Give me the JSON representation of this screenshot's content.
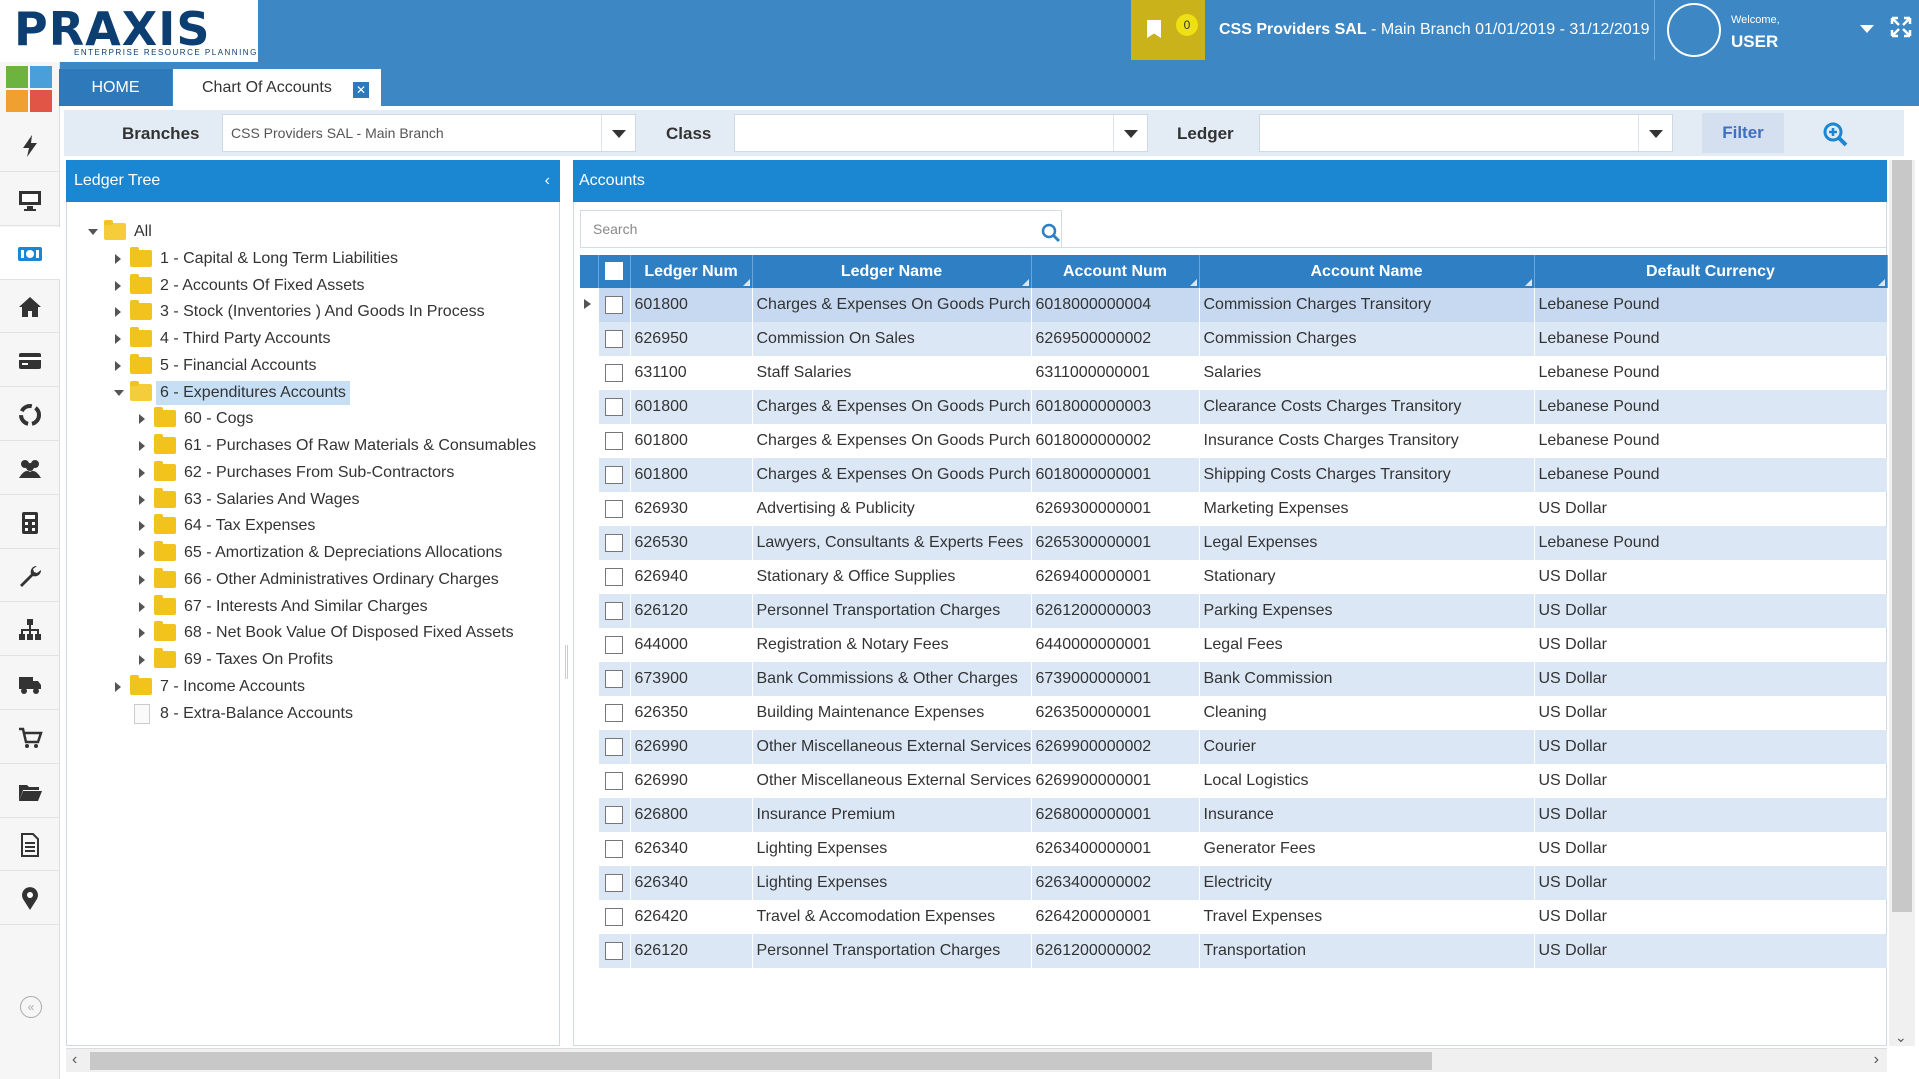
{
  "header": {
    "logo_text": "PRAXIS",
    "logo_tagline": "ENTERPRISE RESOURCE PLANNING",
    "notification_count": "0",
    "company_name": "CSS Providers SAL",
    "company_branch": " - Main Branch 01/01/2019 - 31/12/2019",
    "welcome": "Welcome,",
    "username": "USER"
  },
  "rail": {
    "tile_colors": [
      "#6cb33f",
      "#4a9fd8",
      "#f0a030",
      "#e05545"
    ],
    "icons": [
      "bolt-icon",
      "monitor-icon",
      "cash-icon",
      "home-icon",
      "credit-card-icon",
      "recycle-icon",
      "users-icon",
      "calculator-icon",
      "wrench-icon",
      "org-chart-icon",
      "truck-icon",
      "cart-icon",
      "folder-open-icon",
      "document-icon",
      "map-pin-icon"
    ],
    "active_index": 2
  },
  "tabs": {
    "home": "HOME",
    "active": "Chart Of Accounts",
    "close_symbol": "✕"
  },
  "filters": {
    "branches_label": "Branches",
    "branches_value": "CSS Providers SAL - Main Branch",
    "class_label": "Class",
    "class_value": "",
    "ledger_label": "Ledger",
    "ledger_value": "",
    "filter_button": "Filter"
  },
  "tree": {
    "title": "Ledger Tree",
    "collapse_symbol": "‹",
    "items": [
      {
        "label": "All",
        "level": 0,
        "state": "open",
        "type": "folder"
      },
      {
        "label": "1 - Capital & Long Term Liabilities",
        "level": 1,
        "state": "closed",
        "type": "folder"
      },
      {
        "label": "2 - Accounts Of Fixed Assets",
        "level": 1,
        "state": "closed",
        "type": "folder"
      },
      {
        "label": "3 - Stock (Inventories ) And Goods In Process",
        "level": 1,
        "state": "closed",
        "type": "folder"
      },
      {
        "label": "4 - Third Party Accounts",
        "level": 1,
        "state": "closed",
        "type": "folder"
      },
      {
        "label": "5 - Financial Accounts",
        "level": 1,
        "state": "closed",
        "type": "folder"
      },
      {
        "label": "6 - Expenditures Accounts",
        "level": 1,
        "state": "open",
        "type": "folder",
        "selected": true
      },
      {
        "label": "60 - Cogs",
        "level": 2,
        "state": "closed",
        "type": "folder"
      },
      {
        "label": "61 - Purchases Of Raw Materials & Consumables",
        "level": 2,
        "state": "closed",
        "type": "folder"
      },
      {
        "label": "62 - Purchases From Sub-Contractors",
        "level": 2,
        "state": "closed",
        "type": "folder"
      },
      {
        "label": "63 - Salaries And Wages",
        "level": 2,
        "state": "closed",
        "type": "folder"
      },
      {
        "label": "64 - Tax Expenses",
        "level": 2,
        "state": "closed",
        "type": "folder"
      },
      {
        "label": "65 - Amortization & Depreciations Allocations",
        "level": 2,
        "state": "closed",
        "type": "folder"
      },
      {
        "label": "66 - Other Administratives Ordinary Charges",
        "level": 2,
        "state": "closed",
        "type": "folder"
      },
      {
        "label": "67 - Interests And Similar Charges",
        "level": 2,
        "state": "closed",
        "type": "folder"
      },
      {
        "label": "68 - Net Book Value Of Disposed Fixed Assets",
        "level": 2,
        "state": "closed",
        "type": "folder"
      },
      {
        "label": "69 - Taxes On Profits",
        "level": 2,
        "state": "closed",
        "type": "folder"
      },
      {
        "label": "7 - Income Accounts",
        "level": 1,
        "state": "closed",
        "type": "folder"
      },
      {
        "label": "8 - Extra-Balance Accounts",
        "level": 1,
        "state": "leaf",
        "type": "file"
      }
    ]
  },
  "accounts": {
    "title": "Accounts",
    "search_placeholder": "Search",
    "columns": [
      "Ledger Num",
      "Ledger Name",
      "Account Num",
      "Account Name",
      "Default Currency"
    ],
    "rows": [
      [
        "601800",
        "Charges & Expenses On Goods Purchasing",
        "6018000000004",
        "Commission Charges Transitory",
        "Lebanese Pound"
      ],
      [
        "626950",
        "Commission On Sales",
        "6269500000002",
        "Commission Charges",
        "Lebanese Pound"
      ],
      [
        "631100",
        "Staff Salaries",
        "6311000000001",
        "Salaries",
        "Lebanese Pound"
      ],
      [
        "601800",
        "Charges & Expenses On Goods Purchasing",
        "6018000000003",
        "Clearance Costs Charges Transitory",
        "Lebanese Pound"
      ],
      [
        "601800",
        "Charges & Expenses On Goods Purchasing",
        "6018000000002",
        "Insurance Costs Charges Transitory",
        "Lebanese Pound"
      ],
      [
        "601800",
        "Charges & Expenses On Goods Purchasing",
        "6018000000001",
        "Shipping Costs Charges Transitory",
        "Lebanese Pound"
      ],
      [
        "626930",
        "Advertising & Publicity",
        "6269300000001",
        "Marketing Expenses",
        "US Dollar"
      ],
      [
        "626530",
        "Lawyers, Consultants & Experts Fees",
        "6265300000001",
        "Legal Expenses",
        "Lebanese Pound"
      ],
      [
        "626940",
        "Stationary & Office Supplies",
        "6269400000001",
        "Stationary",
        "US Dollar"
      ],
      [
        "626120",
        "Personnel Transportation Charges",
        "6261200000003",
        "Parking Expenses",
        "US Dollar"
      ],
      [
        "644000",
        "Registration & Notary Fees",
        "6440000000001",
        "Legal Fees",
        "US Dollar"
      ],
      [
        "673900",
        "Bank Commissions & Other Charges",
        "6739000000001",
        "Bank Commission",
        "US Dollar"
      ],
      [
        "626350",
        "Building Maintenance Expenses",
        "6263500000001",
        "Cleaning",
        "US Dollar"
      ],
      [
        "626990",
        "Other Miscellaneous External Services",
        "6269900000002",
        "Courier",
        "US Dollar"
      ],
      [
        "626990",
        "Other Miscellaneous External Services",
        "6269900000001",
        "Local Logistics",
        "US Dollar"
      ],
      [
        "626800",
        "Insurance Premium",
        "6268000000001",
        "Insurance",
        "US Dollar"
      ],
      [
        "626340",
        "Lighting Expenses",
        "6263400000001",
        "Generator Fees",
        "US Dollar"
      ],
      [
        "626340",
        "Lighting Expenses",
        "6263400000002",
        "Electricity",
        "US Dollar"
      ],
      [
        "626420",
        "Travel & Accomodation Expenses",
        "6264200000001",
        "Travel Expenses",
        "US Dollar"
      ],
      [
        "626120",
        "Personnel Transportation Charges",
        "6261200000002",
        "Transportation",
        "US Dollar"
      ]
    ]
  },
  "colors": {
    "topbar": "#3c87c4",
    "panel_header": "#1b86d2",
    "grid_header": "#2f7fc4",
    "row_alt": "#dce7f6",
    "notif": "#c9b21a"
  }
}
